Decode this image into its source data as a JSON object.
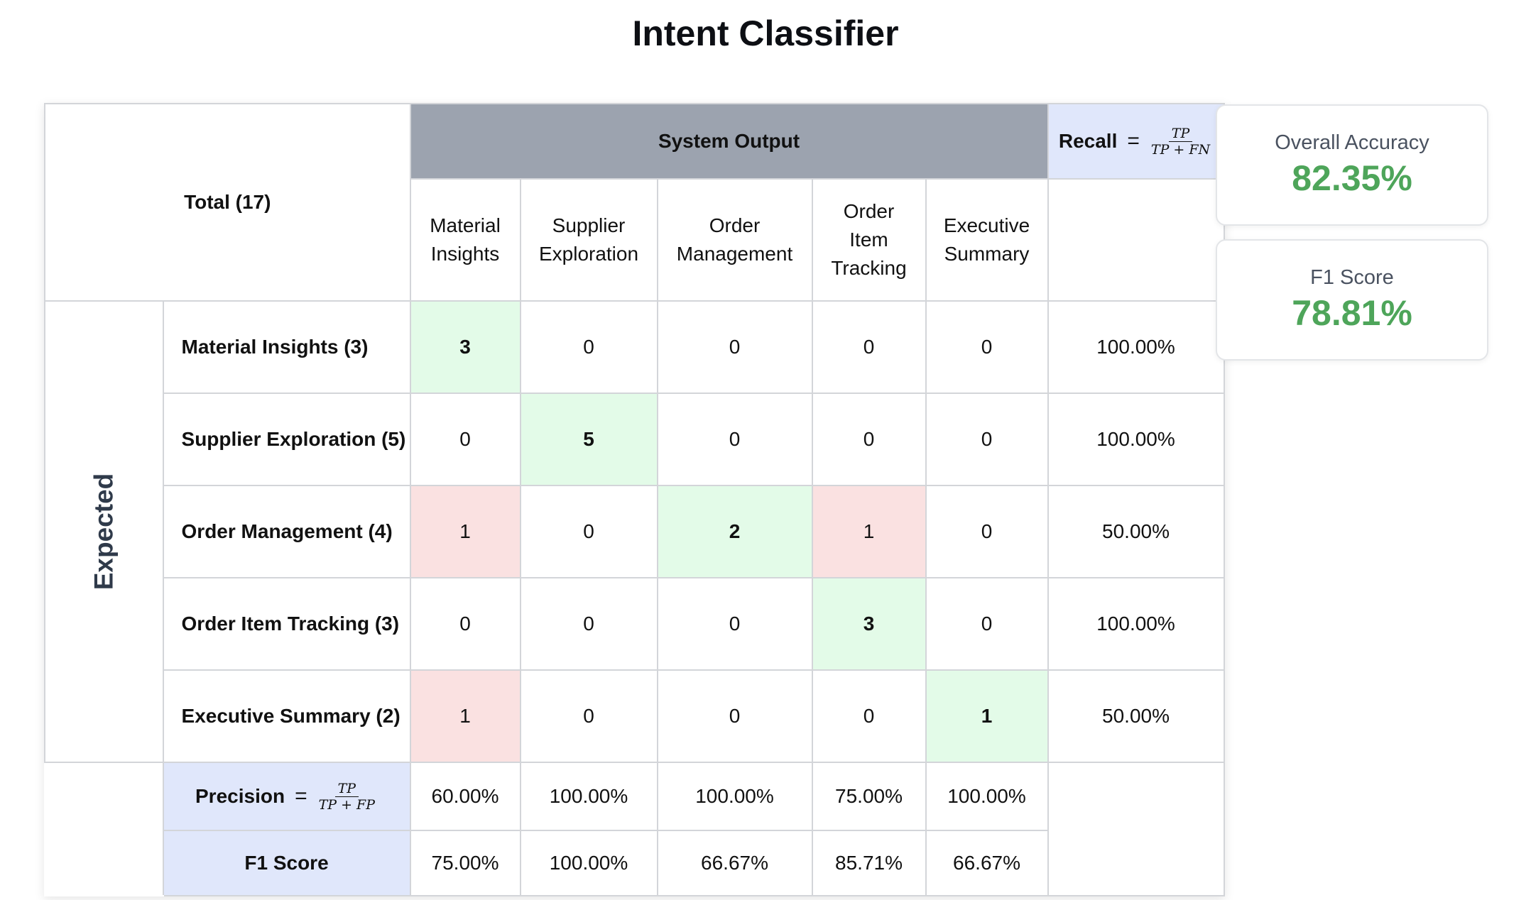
{
  "title": "Intent Classifier",
  "matrix": {
    "total_label": "Total (17)",
    "system_output_label": "System Output",
    "recall_label": "Recall",
    "recall_formula": {
      "num": "TP",
      "den": "TP + FN"
    },
    "expected_label": "Expected",
    "precision_label": "Precision",
    "precision_formula": {
      "num": "TP",
      "den": "TP + FP"
    },
    "f1_label": "F1 Score",
    "columns": [
      {
        "line1": "Material",
        "line2": "Insights",
        "line3": ""
      },
      {
        "line1": "Supplier",
        "line2": "Exploration",
        "line3": ""
      },
      {
        "line1": "Order",
        "line2": "Management",
        "line3": ""
      },
      {
        "line1": "Order",
        "line2": "Item",
        "line3": "Tracking"
      },
      {
        "line1": "Executive",
        "line2": "Summary",
        "line3": ""
      }
    ],
    "rows": [
      {
        "label": "Material Insights (3)",
        "cells": [
          "3",
          "0",
          "0",
          "0",
          "0"
        ],
        "recall": "100.00%"
      },
      {
        "label": "Supplier Exploration (5)",
        "cells": [
          "0",
          "5",
          "0",
          "0",
          "0"
        ],
        "recall": "100.00%"
      },
      {
        "label": "Order Management (4)",
        "cells": [
          "1",
          "0",
          "2",
          "1",
          "0"
        ],
        "recall": "50.00%"
      },
      {
        "label": "Order Item Tracking (3)",
        "cells": [
          "0",
          "0",
          "0",
          "3",
          "0"
        ],
        "recall": "100.00%"
      },
      {
        "label": "Executive Summary (2)",
        "cells": [
          "1",
          "0",
          "0",
          "0",
          "1"
        ],
        "recall": "50.00%"
      }
    ],
    "precision": [
      "60.00%",
      "100.00%",
      "100.00%",
      "75.00%",
      "100.00%"
    ],
    "f1": [
      "75.00%",
      "100.00%",
      "66.67%",
      "85.71%",
      "66.67%"
    ]
  },
  "metrics": {
    "accuracy_label": "Overall Accuracy",
    "accuracy_value": "82.35%",
    "f1_label": "F1 Score",
    "f1_value": "78.81%"
  },
  "colors": {
    "system_output_bg": "#9ca3af",
    "formula_bg": "#e0e7fb",
    "correct_bg": "#e3fbe8",
    "error_bg": "#fae1e1",
    "metric_value": "#4ea55a"
  }
}
